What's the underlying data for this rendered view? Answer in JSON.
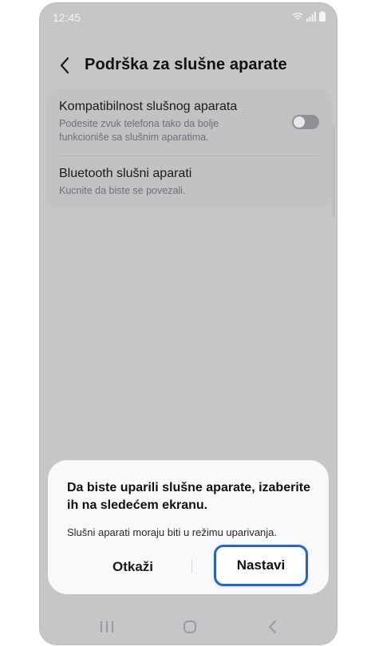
{
  "status_bar": {
    "time": "12:45"
  },
  "header": {
    "title": "Podrška za slušne aparate"
  },
  "settings": {
    "items": [
      {
        "title": "Kompatibilnost slušnog aparata",
        "description_line1": "Podesite zvuk telefona tako da bolje",
        "description_line2": "funkcioniše sa slušnim aparatima.",
        "toggle": "off"
      },
      {
        "title": "Bluetooth slušni aparati",
        "description_line1": "Kucnite da biste se povezali."
      }
    ]
  },
  "dialog": {
    "title": "Da biste uparili slušne aparate, izaberite ih na sledećem ekranu.",
    "message": "Slušni aparati moraju biti u režimu uparivanja.",
    "cancel_label": "Otkaži",
    "continue_label": "Nastavi"
  },
  "colors": {
    "accent": "#1f65d6",
    "dim_background": "#c6c6c9",
    "dialog_background": "#f9f9fb"
  },
  "nav_icons": [
    "recents-icon",
    "home-icon",
    "back-icon"
  ]
}
